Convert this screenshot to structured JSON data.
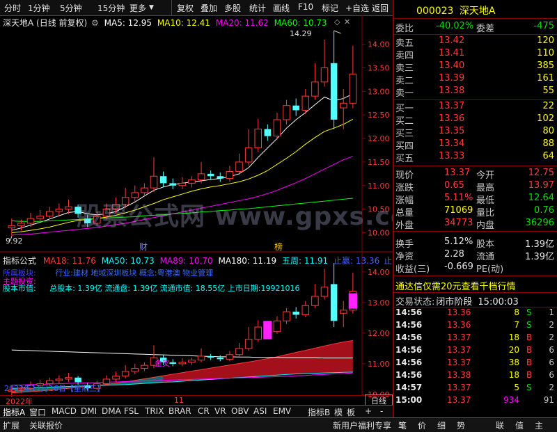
{
  "toolbar": {
    "left": [
      "分时",
      "1分钟",
      "5分钟",
      "15分钟",
      "更多"
    ],
    "right": [
      "复权",
      "叠加",
      "多股",
      "统计",
      "画线",
      "F10",
      "标记",
      "+自选",
      "返回"
    ]
  },
  "main_chart": {
    "title": "深天地A (日线 前复权)",
    "ma": [
      {
        "label": "MA5: 12.95",
        "color": "#ffffff"
      },
      {
        "label": "MA10: 12.41",
        "color": "#ffff00"
      },
      {
        "label": "MA20: 11.62",
        "color": "#ff00ff"
      },
      {
        "label": "MA60: 10.73",
        "color": "#00ff00"
      }
    ],
    "high_label": "14.29",
    "low_label": "9.92",
    "markers": [
      "财",
      "榜"
    ],
    "y_ticks": [
      "14.00",
      "13.50",
      "13.00",
      "12.50",
      "12.00",
      "11.50",
      "11.00",
      "10.50",
      "10.00"
    ]
  },
  "chart_data": [
    {
      "type": "candlestick",
      "title": "深天地A (日线 前复权)",
      "ylim": [
        9.8,
        14.35
      ],
      "high": 14.29,
      "low": 9.92,
      "candles": [
        {
          "o": 10.1,
          "c": 10.15,
          "h": 10.3,
          "l": 9.92
        },
        {
          "o": 10.15,
          "c": 10.2,
          "h": 10.28,
          "l": 10.05
        },
        {
          "o": 10.2,
          "c": 10.3,
          "h": 10.42,
          "l": 10.12
        },
        {
          "o": 10.3,
          "c": 10.35,
          "h": 10.48,
          "l": 10.22
        },
        {
          "o": 10.35,
          "c": 10.45,
          "h": 10.55,
          "l": 10.28
        },
        {
          "o": 10.45,
          "c": 10.5,
          "h": 10.62,
          "l": 10.36
        },
        {
          "o": 10.5,
          "c": 10.55,
          "h": 10.7,
          "l": 10.4
        },
        {
          "o": 10.55,
          "c": 10.4,
          "h": 10.6,
          "l": 10.32
        },
        {
          "o": 10.3,
          "c": 10.2,
          "h": 10.38,
          "l": 10.12
        },
        {
          "o": 10.2,
          "c": 10.35,
          "h": 10.45,
          "l": 10.15
        },
        {
          "o": 10.35,
          "c": 10.5,
          "h": 10.62,
          "l": 10.28
        },
        {
          "o": 10.5,
          "c": 10.6,
          "h": 10.75,
          "l": 10.42
        },
        {
          "o": 10.6,
          "c": 10.75,
          "h": 10.95,
          "l": 10.52
        },
        {
          "o": 10.75,
          "c": 10.85,
          "h": 11.0,
          "l": 10.66
        },
        {
          "o": 10.85,
          "c": 10.95,
          "h": 11.05,
          "l": 10.76
        },
        {
          "o": 10.95,
          "c": 11.2,
          "h": 11.6,
          "l": 10.86
        },
        {
          "o": 11.2,
          "c": 11.05,
          "h": 11.3,
          "l": 10.96
        },
        {
          "o": 11.05,
          "c": 11.0,
          "h": 11.15,
          "l": 10.92
        },
        {
          "o": 11.0,
          "c": 11.05,
          "h": 11.18,
          "l": 10.92
        },
        {
          "o": 11.05,
          "c": 11.12,
          "h": 11.2,
          "l": 10.96
        },
        {
          "o": 11.12,
          "c": 11.25,
          "h": 11.5,
          "l": 11.05
        },
        {
          "o": 11.25,
          "c": 11.2,
          "h": 11.32,
          "l": 11.12
        },
        {
          "o": 11.2,
          "c": 11.15,
          "h": 11.28,
          "l": 11.08
        },
        {
          "o": 11.15,
          "c": 11.3,
          "h": 11.42,
          "l": 11.08
        },
        {
          "o": 11.3,
          "c": 11.5,
          "h": 11.68,
          "l": 11.22
        },
        {
          "o": 11.5,
          "c": 11.8,
          "h": 12.2,
          "l": 11.42
        },
        {
          "o": 11.8,
          "c": 12.2,
          "h": 12.42,
          "l": 11.72
        },
        {
          "o": 12.2,
          "c": 12.05,
          "h": 12.3,
          "l": 11.95
        },
        {
          "o": 12.05,
          "c": 12.4,
          "h": 12.55,
          "l": 11.98
        },
        {
          "o": 12.4,
          "c": 12.7,
          "h": 12.82,
          "l": 12.3
        },
        {
          "o": 12.7,
          "c": 12.6,
          "h": 12.85,
          "l": 12.48
        },
        {
          "o": 12.6,
          "c": 12.9,
          "h": 13.05,
          "l": 12.52
        },
        {
          "o": 12.9,
          "c": 13.2,
          "h": 13.6,
          "l": 12.82
        },
        {
          "o": 13.2,
          "c": 13.5,
          "h": 14.1,
          "l": 13.1
        },
        {
          "o": 13.6,
          "c": 12.4,
          "h": 14.29,
          "l": 12.2
        },
        {
          "o": 12.65,
          "c": 12.75,
          "h": 13.05,
          "l": 12.2
        },
        {
          "o": 12.75,
          "c": 13.37,
          "h": 13.97,
          "l": 12.64
        }
      ],
      "series": [
        {
          "name": "MA5",
          "color": "#ffffff",
          "values": [
            10.05,
            10.1,
            10.16,
            10.22,
            10.29,
            10.36,
            10.43,
            10.45,
            10.4,
            10.38,
            10.4,
            10.45,
            10.55,
            10.65,
            10.78,
            10.9,
            10.97,
            11.02,
            11.05,
            11.08,
            11.1,
            11.13,
            11.15,
            11.19,
            11.25,
            11.38,
            11.6,
            11.8,
            12.0,
            12.22,
            12.4,
            12.55,
            12.72,
            12.88,
            12.8,
            12.85,
            12.95
          ]
        },
        {
          "name": "MA10",
          "color": "#ffff00",
          "values": [
            10.0,
            10.02,
            10.05,
            10.08,
            10.12,
            10.17,
            10.22,
            10.26,
            10.28,
            10.3,
            10.33,
            10.37,
            10.42,
            10.48,
            10.55,
            10.62,
            10.7,
            10.76,
            10.82,
            10.88,
            10.93,
            10.97,
            11.0,
            11.04,
            11.08,
            11.14,
            11.22,
            11.32,
            11.45,
            11.58,
            11.72,
            11.88,
            12.02,
            12.15,
            12.22,
            12.3,
            12.41
          ]
        },
        {
          "name": "MA20",
          "color": "#ff00ff",
          "values": [
            9.95,
            9.96,
            9.97,
            9.99,
            10.01,
            10.03,
            10.05,
            10.07,
            10.09,
            10.11,
            10.14,
            10.17,
            10.2,
            10.24,
            10.28,
            10.32,
            10.36,
            10.4,
            10.44,
            10.48,
            10.52,
            10.56,
            10.6,
            10.64,
            10.68,
            10.72,
            10.77,
            10.83,
            10.9,
            10.98,
            11.06,
            11.15,
            11.25,
            11.35,
            11.45,
            11.55,
            11.62
          ]
        },
        {
          "name": "MA60",
          "color": "#00ff00",
          "values": [
            10.25,
            10.24,
            10.24,
            10.24,
            10.25,
            10.26,
            10.27,
            10.28,
            10.29,
            10.3,
            10.31,
            10.32,
            10.33,
            10.34,
            10.36,
            10.37,
            10.38,
            10.4,
            10.41,
            10.42,
            10.44,
            10.45,
            10.47,
            10.48,
            10.5,
            10.51,
            10.53,
            10.55,
            10.57,
            10.59,
            10.61,
            10.63,
            10.65,
            10.67,
            10.69,
            10.71,
            10.73
          ]
        }
      ]
    },
    {
      "type": "candlestick",
      "title": "指标公式",
      "ylim": [
        10.0,
        14.2
      ],
      "series": [
        {
          "name": "MA18",
          "color": "#ff3c3c",
          "values": [
            10.05,
            10.07,
            10.09,
            10.11,
            10.14,
            10.17,
            10.2,
            10.23,
            10.26,
            10.29,
            10.33,
            10.37,
            10.41,
            10.46,
            10.51,
            10.56,
            10.61,
            10.66,
            10.71,
            10.76,
            10.81,
            10.86,
            10.91,
            10.96,
            11.01,
            11.06,
            11.11,
            11.17,
            11.23,
            11.3,
            11.37,
            11.44,
            11.51,
            11.58,
            11.65,
            11.71,
            11.76
          ]
        },
        {
          "name": "MA50",
          "color": "#00ffff",
          "values": [
            10.2,
            10.21,
            10.22,
            10.23,
            10.24,
            10.25,
            10.26,
            10.27,
            10.28,
            10.29,
            10.3,
            10.31,
            10.32,
            10.34,
            10.36,
            10.38,
            10.4,
            10.41,
            10.43,
            10.45,
            10.47,
            10.49,
            10.51,
            10.53,
            10.55,
            10.57,
            10.59,
            10.61,
            10.63,
            10.65,
            10.67,
            10.68,
            10.69,
            10.7,
            10.71,
            10.72,
            10.73
          ]
        },
        {
          "name": "MA89",
          "color": "#ff00ff",
          "values": [
            10.3,
            10.31,
            10.32,
            10.33,
            10.34,
            10.35,
            10.36,
            10.37,
            10.38,
            10.39,
            10.4,
            10.41,
            10.42,
            10.43,
            10.44,
            10.45,
            10.46,
            10.47,
            10.48,
            10.49,
            10.5,
            10.51,
            10.52,
            10.53,
            10.54,
            10.55,
            10.56,
            10.57,
            10.58,
            10.59,
            10.61,
            10.62,
            10.64,
            10.65,
            10.67,
            10.68,
            10.7
          ]
        },
        {
          "name": "MA180",
          "color": "#ffffff",
          "values": [
            11.45,
            11.44,
            11.43,
            11.42,
            11.41,
            11.4,
            11.39,
            11.38,
            11.37,
            11.36,
            11.35,
            11.34,
            11.33,
            11.32,
            11.31,
            11.3,
            11.29,
            11.28,
            11.27,
            11.26,
            11.25,
            11.24,
            11.23,
            11.23,
            11.22,
            11.22,
            11.21,
            11.21,
            11.21,
            11.2,
            11.2,
            11.2,
            11.2,
            11.19,
            11.19,
            11.19,
            11.19
          ]
        }
      ]
    }
  ],
  "sub_chart": {
    "title": "指标公式",
    "ma": [
      {
        "label": "MA18: 11.76",
        "color": "#ff3c3c"
      },
      {
        "label": "MA50: 10.73",
        "color": "#00ffff"
      },
      {
        "label": "MA89: 10.70",
        "color": "#ff00ff"
      },
      {
        "label": "MA180: 11.19",
        "color": "#ffffff"
      },
      {
        "label": "五周: 11.91",
        "color": "#00ffff"
      },
      {
        "label": "止赢: 13.36",
        "color": "#4060ff"
      },
      {
        "label": "止",
        "color": "#4060ff"
      }
    ],
    "sector_label": "所属板块:",
    "sector_text": "行业:建材   地域深圳板块  概念:粤港澳 物业管理",
    "topic_label": "主题投资:",
    "cap_label": "股本市值:",
    "cap_text": "总股本: 1.39亿 流通盘: 1.39亿 流通市值: 18.55亿 上市日期:19921016",
    "cross_label": "金叉",
    "date_label": "2022年11月16日【星期三】",
    "y_ticks": [
      "14.00",
      "13.00",
      "12.00",
      "11.00",
      "10.00"
    ]
  },
  "time_axis": {
    "year": "2022年",
    "month": "11",
    "period": "日线"
  },
  "bottom_tabs": [
    "指标A",
    "窗口",
    "MACD",
    "DMI",
    "DMA",
    "FSL",
    "TRIX",
    "BRAR",
    "CR",
    "VR",
    "OBV",
    "ASI",
    "EMV"
  ],
  "bottom_right_tabs": [
    "指标B",
    "模",
    "板",
    "+",
    "-"
  ],
  "footer": {
    "left": [
      "扩展",
      "关联报价"
    ],
    "promo": "新用户福利专享",
    "icons": [
      "笔",
      "价",
      "细",
      "势",
      "联",
      "值",
      "主"
    ]
  },
  "watermark": "股票公式网  www.gpxs.com",
  "quote": {
    "code": "000023",
    "name": "深天地A",
    "ratio_label": "委比",
    "ratio": "-40.02%",
    "diff_label": "委差",
    "diff": "-475",
    "sells": [
      {
        "label": "卖五",
        "price": "13.42",
        "vol": "120"
      },
      {
        "label": "卖四",
        "price": "13.41",
        "vol": "110"
      },
      {
        "label": "卖三",
        "price": "13.40",
        "vol": "385"
      },
      {
        "label": "卖二",
        "price": "13.39",
        "vol": "161"
      },
      {
        "label": "卖一",
        "price": "13.38",
        "vol": "55"
      }
    ],
    "buys": [
      {
        "label": "买一",
        "price": "13.37",
        "vol": "22"
      },
      {
        "label": "买二",
        "price": "13.36",
        "vol": "102"
      },
      {
        "label": "买三",
        "price": "13.35",
        "vol": "80"
      },
      {
        "label": "买四",
        "price": "13.34",
        "vol": "88"
      },
      {
        "label": "买五",
        "price": "13.33",
        "vol": "64"
      }
    ],
    "stats": [
      {
        "l1": "现价",
        "v1": "13.37",
        "c1": "red",
        "l2": "今开",
        "v2": "12.75",
        "c2": "red"
      },
      {
        "l1": "涨跌",
        "v1": "0.65",
        "c1": "red",
        "l2": "最高",
        "v2": "13.97",
        "c2": "red"
      },
      {
        "l1": "涨幅",
        "v1": "5.11%",
        "c1": "red",
        "l2": "最低",
        "v2": "12.64",
        "c2": "green"
      },
      {
        "l1": "总量",
        "v1": "71069",
        "c1": "yellow",
        "l2": "量比",
        "v2": "0.76",
        "c2": "green"
      },
      {
        "l1": "外盘",
        "v1": "34773",
        "c1": "red",
        "l2": "内盘",
        "v2": "36296",
        "c2": "green"
      }
    ],
    "stats2": [
      {
        "l1": "换手",
        "v1": "5.12%",
        "l2": "股本",
        "v2": "1.39亿"
      },
      {
        "l1": "净资",
        "v1": "2.28",
        "l2": "流通",
        "v2": "1.39亿"
      },
      {
        "l1": "收益(三)",
        "v1": "-0.669",
        "l2": "PE(动)",
        "v2": ""
      }
    ],
    "ad": "通达信仅需20元查看千档行情",
    "trade_status_label": "交易状态:",
    "trade_status": "闭市阶段",
    "trade_time": "15:00:03",
    "ticks": [
      {
        "t": "14:56",
        "p": "13.36",
        "v": "8",
        "s": "S",
        "n": "1"
      },
      {
        "t": "14:56",
        "p": "13.36",
        "v": "7",
        "s": "S",
        "n": "2"
      },
      {
        "t": "14:56",
        "p": "13.37",
        "v": "18",
        "s": "B",
        "n": "2"
      },
      {
        "t": "14:56",
        "p": "13.37",
        "v": "20",
        "s": "B",
        "n": "6"
      },
      {
        "t": "14:56",
        "p": "13.37",
        "v": "38",
        "s": "B",
        "n": "6"
      },
      {
        "t": "14:56",
        "p": "13.38",
        "v": "18",
        "s": "B",
        "n": "6"
      },
      {
        "t": "14:57",
        "p": "13.37",
        "v": "5",
        "s": "S",
        "n": "2"
      },
      {
        "t": "15:00",
        "p": "13.37",
        "v": "934",
        "s": "",
        "n": "91"
      }
    ]
  }
}
